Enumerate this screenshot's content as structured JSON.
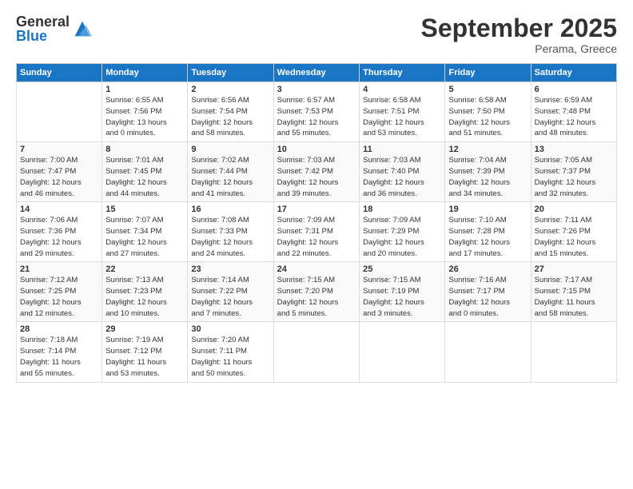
{
  "logo": {
    "general": "General",
    "blue": "Blue"
  },
  "title": "September 2025",
  "location": "Perama, Greece",
  "days_of_week": [
    "Sunday",
    "Monday",
    "Tuesday",
    "Wednesday",
    "Thursday",
    "Friday",
    "Saturday"
  ],
  "weeks": [
    [
      {
        "day": "",
        "info": ""
      },
      {
        "day": "1",
        "info": "Sunrise: 6:55 AM\nSunset: 7:56 PM\nDaylight: 13 hours\nand 0 minutes."
      },
      {
        "day": "2",
        "info": "Sunrise: 6:56 AM\nSunset: 7:54 PM\nDaylight: 12 hours\nand 58 minutes."
      },
      {
        "day": "3",
        "info": "Sunrise: 6:57 AM\nSunset: 7:53 PM\nDaylight: 12 hours\nand 55 minutes."
      },
      {
        "day": "4",
        "info": "Sunrise: 6:58 AM\nSunset: 7:51 PM\nDaylight: 12 hours\nand 53 minutes."
      },
      {
        "day": "5",
        "info": "Sunrise: 6:58 AM\nSunset: 7:50 PM\nDaylight: 12 hours\nand 51 minutes."
      },
      {
        "day": "6",
        "info": "Sunrise: 6:59 AM\nSunset: 7:48 PM\nDaylight: 12 hours\nand 48 minutes."
      }
    ],
    [
      {
        "day": "7",
        "info": "Sunrise: 7:00 AM\nSunset: 7:47 PM\nDaylight: 12 hours\nand 46 minutes."
      },
      {
        "day": "8",
        "info": "Sunrise: 7:01 AM\nSunset: 7:45 PM\nDaylight: 12 hours\nand 44 minutes."
      },
      {
        "day": "9",
        "info": "Sunrise: 7:02 AM\nSunset: 7:44 PM\nDaylight: 12 hours\nand 41 minutes."
      },
      {
        "day": "10",
        "info": "Sunrise: 7:03 AM\nSunset: 7:42 PM\nDaylight: 12 hours\nand 39 minutes."
      },
      {
        "day": "11",
        "info": "Sunrise: 7:03 AM\nSunset: 7:40 PM\nDaylight: 12 hours\nand 36 minutes."
      },
      {
        "day": "12",
        "info": "Sunrise: 7:04 AM\nSunset: 7:39 PM\nDaylight: 12 hours\nand 34 minutes."
      },
      {
        "day": "13",
        "info": "Sunrise: 7:05 AM\nSunset: 7:37 PM\nDaylight: 12 hours\nand 32 minutes."
      }
    ],
    [
      {
        "day": "14",
        "info": "Sunrise: 7:06 AM\nSunset: 7:36 PM\nDaylight: 12 hours\nand 29 minutes."
      },
      {
        "day": "15",
        "info": "Sunrise: 7:07 AM\nSunset: 7:34 PM\nDaylight: 12 hours\nand 27 minutes."
      },
      {
        "day": "16",
        "info": "Sunrise: 7:08 AM\nSunset: 7:33 PM\nDaylight: 12 hours\nand 24 minutes."
      },
      {
        "day": "17",
        "info": "Sunrise: 7:09 AM\nSunset: 7:31 PM\nDaylight: 12 hours\nand 22 minutes."
      },
      {
        "day": "18",
        "info": "Sunrise: 7:09 AM\nSunset: 7:29 PM\nDaylight: 12 hours\nand 20 minutes."
      },
      {
        "day": "19",
        "info": "Sunrise: 7:10 AM\nSunset: 7:28 PM\nDaylight: 12 hours\nand 17 minutes."
      },
      {
        "day": "20",
        "info": "Sunrise: 7:11 AM\nSunset: 7:26 PM\nDaylight: 12 hours\nand 15 minutes."
      }
    ],
    [
      {
        "day": "21",
        "info": "Sunrise: 7:12 AM\nSunset: 7:25 PM\nDaylight: 12 hours\nand 12 minutes."
      },
      {
        "day": "22",
        "info": "Sunrise: 7:13 AM\nSunset: 7:23 PM\nDaylight: 12 hours\nand 10 minutes."
      },
      {
        "day": "23",
        "info": "Sunrise: 7:14 AM\nSunset: 7:22 PM\nDaylight: 12 hours\nand 7 minutes."
      },
      {
        "day": "24",
        "info": "Sunrise: 7:15 AM\nSunset: 7:20 PM\nDaylight: 12 hours\nand 5 minutes."
      },
      {
        "day": "25",
        "info": "Sunrise: 7:15 AM\nSunset: 7:19 PM\nDaylight: 12 hours\nand 3 minutes."
      },
      {
        "day": "26",
        "info": "Sunrise: 7:16 AM\nSunset: 7:17 PM\nDaylight: 12 hours\nand 0 minutes."
      },
      {
        "day": "27",
        "info": "Sunrise: 7:17 AM\nSunset: 7:15 PM\nDaylight: 11 hours\nand 58 minutes."
      }
    ],
    [
      {
        "day": "28",
        "info": "Sunrise: 7:18 AM\nSunset: 7:14 PM\nDaylight: 11 hours\nand 55 minutes."
      },
      {
        "day": "29",
        "info": "Sunrise: 7:19 AM\nSunset: 7:12 PM\nDaylight: 11 hours\nand 53 minutes."
      },
      {
        "day": "30",
        "info": "Sunrise: 7:20 AM\nSunset: 7:11 PM\nDaylight: 11 hours\nand 50 minutes."
      },
      {
        "day": "",
        "info": ""
      },
      {
        "day": "",
        "info": ""
      },
      {
        "day": "",
        "info": ""
      },
      {
        "day": "",
        "info": ""
      }
    ]
  ]
}
